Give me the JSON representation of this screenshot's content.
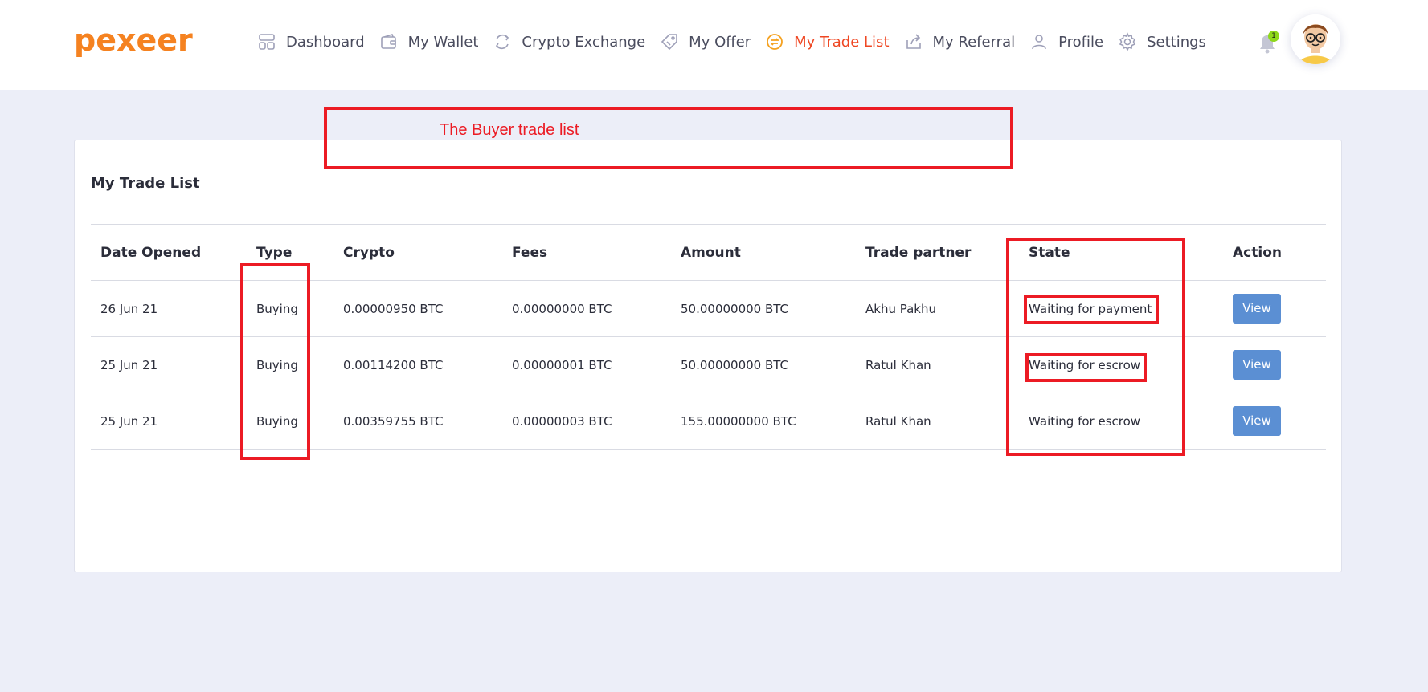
{
  "brand": {
    "name": "pexeer",
    "color": "#f58220"
  },
  "nav": {
    "items": [
      {
        "label": "Dashboard",
        "icon": "dashboard-icon"
      },
      {
        "label": "My Wallet",
        "icon": "wallet-icon"
      },
      {
        "label": "Crypto Exchange",
        "icon": "exchange-icon"
      },
      {
        "label": "My Offer",
        "icon": "offer-tag-icon"
      },
      {
        "label": "My Trade List",
        "icon": "trade-swap-icon",
        "active": true
      },
      {
        "label": "My Referral",
        "icon": "share-icon"
      },
      {
        "label": "Profile",
        "icon": "user-icon"
      },
      {
        "label": "Settings",
        "icon": "gear-icon"
      }
    ],
    "active_color": "#ef4723"
  },
  "notifications": {
    "count": "1",
    "icon": "bell-icon"
  },
  "annotation": {
    "label": "The Buyer trade list",
    "color": "#ec1b24"
  },
  "card": {
    "title": "My Trade List"
  },
  "table": {
    "headers": [
      "Date Opened",
      "Type",
      "Crypto",
      "Fees",
      "Amount",
      "Trade partner",
      "State",
      "Action"
    ],
    "rows": [
      {
        "date": "26 Jun 21",
        "type": "Buying",
        "crypto": "0.00000950 BTC",
        "fees": "0.00000000 BTC",
        "amount": "50.00000000 BTC",
        "partner": "Akhu Pakhu",
        "state": "Waiting for payment",
        "action": "View"
      },
      {
        "date": "25 Jun 21",
        "type": "Buying",
        "crypto": "0.00114200 BTC",
        "fees": "0.00000001 BTC",
        "amount": "50.00000000 BTC",
        "partner": "Ratul Khan",
        "state": "Waiting for escrow",
        "action": "View"
      },
      {
        "date": "25 Jun 21",
        "type": "Buying",
        "crypto": "0.00359755 BTC",
        "fees": "0.00000003 BTC",
        "amount": "155.00000000 BTC",
        "partner": "Ratul Khan",
        "state": "Waiting for escrow",
        "action": "View"
      }
    ]
  }
}
